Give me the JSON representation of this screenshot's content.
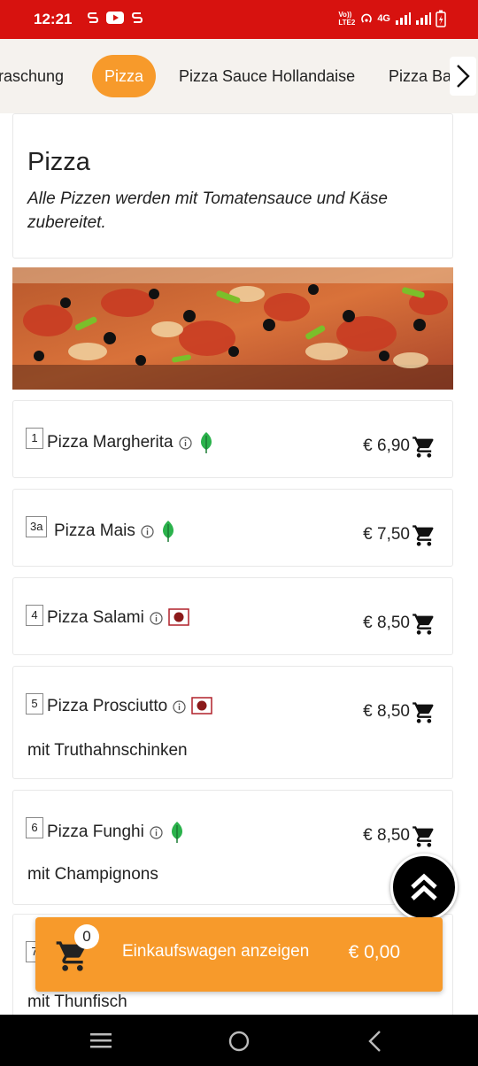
{
  "status_bar": {
    "time": "12:21",
    "network": "4G",
    "volte": "Vo)) LTE2",
    "bg_color": "#d7120f"
  },
  "categories": {
    "tabs": [
      {
        "label": "rraschung",
        "active": false
      },
      {
        "label": "Pizza",
        "active": true
      },
      {
        "label": "Pizza Sauce Hollandaise",
        "active": false
      },
      {
        "label": "Pizza Ba",
        "active": false
      }
    ],
    "next_icon": "chevron-right-icon",
    "active_color": "#f79a2b"
  },
  "section": {
    "title": "Pizza",
    "description": "Alle Pizzen werden mit Tomatensauce und Käse zubereitet."
  },
  "items": [
    {
      "number": "1",
      "name": "Pizza Margherita",
      "badge": "leaf-icon",
      "price": "€ 6,90",
      "description": ""
    },
    {
      "number": "3a",
      "name": "Pizza Mais",
      "badge": "leaf-icon",
      "price": "€ 7,50",
      "description": ""
    },
    {
      "number": "4",
      "name": "Pizza Salami",
      "badge": "meat-icon",
      "price": "€ 8,50",
      "description": ""
    },
    {
      "number": "5",
      "name": "Pizza Prosciutto",
      "badge": "meat-icon",
      "price": "€ 8,50",
      "description": "mit Truthahnschinken"
    },
    {
      "number": "6",
      "name": "Pizza Funghi",
      "badge": "leaf-icon",
      "price": "€ 8,50",
      "description": "mit Champignons"
    },
    {
      "number": "7",
      "name": "",
      "badge": "",
      "price": "",
      "description": "mit Thunfisch"
    }
  ],
  "cart": {
    "count": "0",
    "label": "Einkaufswagen anzeigen",
    "total": "€ 0,00",
    "color": "#f79a2b"
  }
}
